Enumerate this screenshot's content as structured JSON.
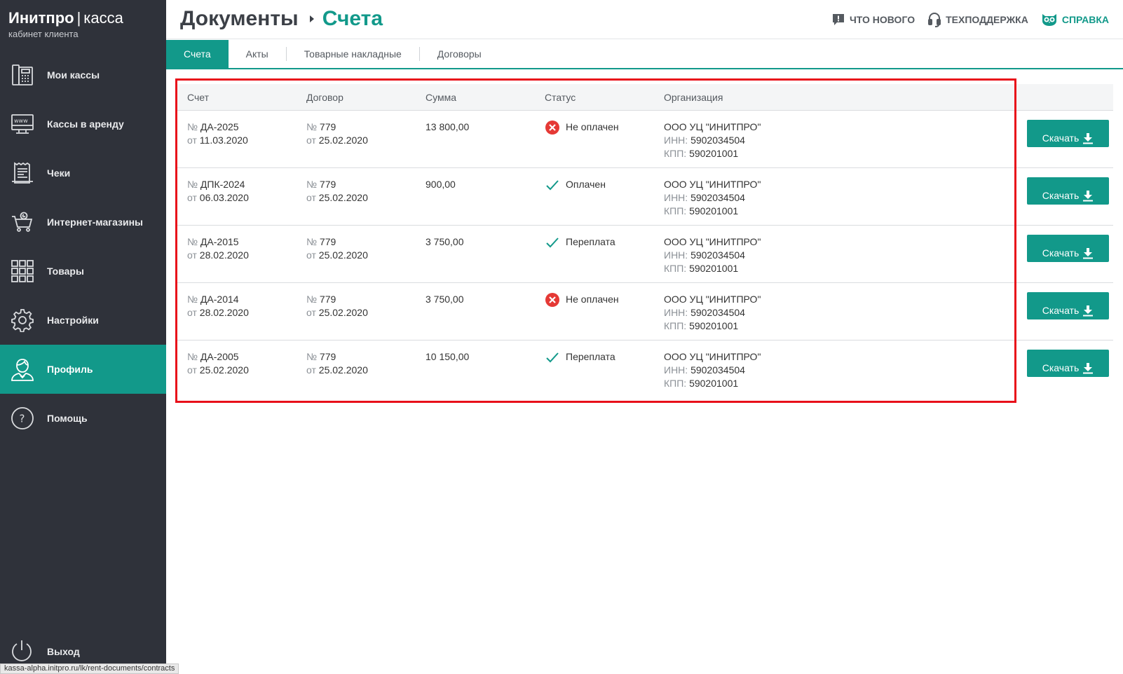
{
  "brand": {
    "name": "Инитпро",
    "sep": "|",
    "product": "касса",
    "subtitle": "кабинет клиента"
  },
  "sidebar": {
    "items": [
      {
        "label": "Мои кассы",
        "icon": "cash-register-icon"
      },
      {
        "label": "Кассы в аренду",
        "icon": "www-monitor-icon"
      },
      {
        "label": "Чеки",
        "icon": "receipt-icon"
      },
      {
        "label": "Интернет-магазины",
        "icon": "shopping-cart-icon"
      },
      {
        "label": "Товары",
        "icon": "grid-icon"
      },
      {
        "label": "Настройки",
        "icon": "gear-icon"
      },
      {
        "label": "Профиль",
        "icon": "user-icon",
        "active": true
      },
      {
        "label": "Помощь",
        "icon": "question-icon"
      }
    ],
    "logout": "Выход"
  },
  "statusbar_url": "kassa-alpha.initpro.ru/lk/rent-documents/contracts",
  "header": {
    "crumb_main": "Документы",
    "crumb_current": "Счета",
    "links": {
      "news": "ЧТО НОВОГО",
      "support": "ТЕХПОДДЕРЖКА",
      "help": "СПРАВКА"
    }
  },
  "tabs": [
    "Счета",
    "Акты",
    "Товарные накладные",
    "Договоры"
  ],
  "table": {
    "headers": [
      "Счет",
      "Договор",
      "Сумма",
      "Статус",
      "Организация"
    ],
    "number_prefix": "№",
    "date_prefix": "от",
    "inn_label": "ИНН:",
    "kpp_label": "КПП:",
    "download_label": "Скачать",
    "rows": [
      {
        "invoice": "ДА-2025",
        "invoice_date": "11.03.2020",
        "contract": "779",
        "contract_date": "25.02.2020",
        "sum": "13 800,00",
        "status": "Не оплачен",
        "status_type": "unpaid",
        "org": "ООО УЦ \"ИНИТПРО\"",
        "inn": "5902034504",
        "kpp": "590201001"
      },
      {
        "invoice": "ДПК-2024",
        "invoice_date": "06.03.2020",
        "contract": "779",
        "contract_date": "25.02.2020",
        "sum": "900,00",
        "status": "Оплачен",
        "status_type": "paid",
        "org": "ООО УЦ \"ИНИТПРО\"",
        "inn": "5902034504",
        "kpp": "590201001"
      },
      {
        "invoice": "ДА-2015",
        "invoice_date": "28.02.2020",
        "contract": "779",
        "contract_date": "25.02.2020",
        "sum": "3 750,00",
        "status": "Переплата",
        "status_type": "paid",
        "org": "ООО УЦ \"ИНИТПРО\"",
        "inn": "5902034504",
        "kpp": "590201001"
      },
      {
        "invoice": "ДА-2014",
        "invoice_date": "28.02.2020",
        "contract": "779",
        "contract_date": "25.02.2020",
        "sum": "3 750,00",
        "status": "Не оплачен",
        "status_type": "unpaid",
        "org": "ООО УЦ \"ИНИТПРО\"",
        "inn": "5902034504",
        "kpp": "590201001"
      },
      {
        "invoice": "ДА-2005",
        "invoice_date": "25.02.2020",
        "contract": "779",
        "contract_date": "25.02.2020",
        "sum": "10 150,00",
        "status": "Переплата",
        "status_type": "paid",
        "org": "ООО УЦ \"ИНИТПРО\"",
        "inn": "5902034504",
        "kpp": "590201001"
      }
    ]
  },
  "colors": {
    "sidebar": "#2f323a",
    "accent": "#12998a",
    "error": "#e53935",
    "highlight_frame": "#e8101a"
  }
}
